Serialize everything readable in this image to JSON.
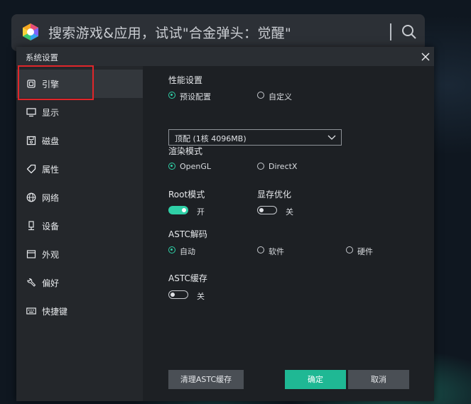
{
  "search": {
    "placeholder": "搜索游戏&应用，试试\"合金弹头：觉醒\""
  },
  "dialog": {
    "title": "系统设置"
  },
  "sidebar": {
    "items": [
      {
        "label": "引擎",
        "icon": "chip-icon"
      },
      {
        "label": "显示",
        "icon": "monitor-icon"
      },
      {
        "label": "磁盘",
        "icon": "disk-icon"
      },
      {
        "label": "属性",
        "icon": "tag-icon"
      },
      {
        "label": "网络",
        "icon": "globe-icon"
      },
      {
        "label": "设备",
        "icon": "device-icon"
      },
      {
        "label": "外观",
        "icon": "window-icon"
      },
      {
        "label": "偏好",
        "icon": "wrench-icon"
      },
      {
        "label": "快捷键",
        "icon": "keyboard-icon"
      }
    ],
    "active_index": 0
  },
  "performance": {
    "label": "性能设置",
    "options": [
      "预设配置",
      "自定义"
    ],
    "selected": "预设配置",
    "preset_value": "顶配 (1核 4096MB)"
  },
  "render": {
    "label": "渲染模式",
    "options": [
      "OpenGL",
      "DirectX"
    ],
    "selected": "OpenGL"
  },
  "root": {
    "label": "Root模式",
    "state_label": "开",
    "enabled": true
  },
  "vram": {
    "label": "显存优化",
    "state_label": "关",
    "enabled": false
  },
  "astc_decode": {
    "label": "ASTC解码",
    "options": [
      "自动",
      "软件",
      "硬件"
    ],
    "selected": "自动"
  },
  "astc_cache": {
    "label": "ASTC缓存",
    "state_label": "关",
    "enabled": false
  },
  "buttons": {
    "clear_cache": "清理ASTC缓存",
    "confirm": "确定",
    "cancel": "取消"
  },
  "colors": {
    "accent": "#2fd0a7",
    "confirm": "#1fb894",
    "highlight": "#e0262a"
  }
}
